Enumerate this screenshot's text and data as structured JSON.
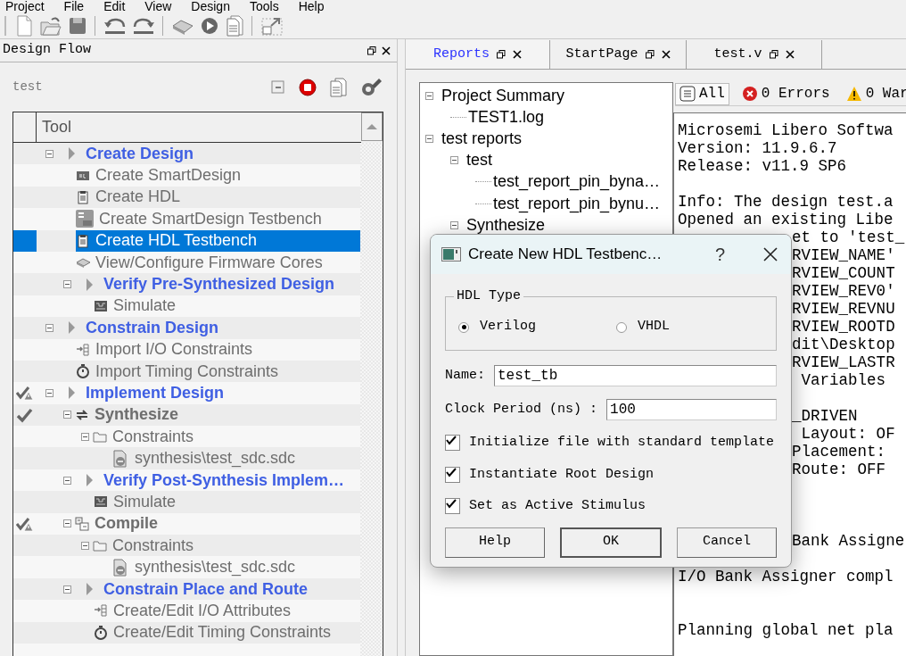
{
  "menu": [
    "Project",
    "File",
    "Edit",
    "View",
    "Design",
    "Tools",
    "Help"
  ],
  "design_flow": {
    "title": "Design Flow",
    "project": "test",
    "column": "Tool",
    "tree": [
      {
        "label": "Create Design",
        "kind": "category",
        "expanded": true,
        "selected": false,
        "checked": false,
        "warning": false,
        "children": [
          {
            "label": "Create SmartDesign",
            "kind": "item",
            "selected": false,
            "checked": false,
            "warning": false
          },
          {
            "label": "Create HDL",
            "kind": "item",
            "selected": false,
            "checked": false,
            "warning": false
          },
          {
            "label": "Create SmartDesign Testbench",
            "kind": "item",
            "selected": false,
            "checked": false,
            "warning": false
          },
          {
            "label": "Create HDL Testbench",
            "kind": "item",
            "selected": true,
            "checked": false,
            "warning": false
          },
          {
            "label": "View/Configure Firmware Cores",
            "kind": "item",
            "selected": false,
            "checked": false,
            "warning": false
          },
          {
            "label": "Verify Pre-Synthesized Design",
            "kind": "category",
            "expanded": true,
            "selected": false,
            "checked": false,
            "warning": false,
            "children": [
              {
                "label": "Simulate",
                "kind": "item",
                "selected": false,
                "checked": false,
                "warning": false
              }
            ]
          }
        ]
      },
      {
        "label": "Constrain Design",
        "kind": "category",
        "expanded": true,
        "selected": false,
        "checked": false,
        "warning": false,
        "children": [
          {
            "label": "Import I/O Constraints",
            "kind": "item",
            "selected": false,
            "checked": false,
            "warning": false
          },
          {
            "label": "Import Timing Constraints",
            "kind": "item",
            "selected": false,
            "checked": false,
            "warning": false
          }
        ]
      },
      {
        "label": "Implement Design",
        "kind": "category",
        "expanded": true,
        "selected": false,
        "checked": true,
        "warning": true,
        "children": [
          {
            "label": "Synthesize",
            "kind": "step",
            "expanded": true,
            "selected": false,
            "checked": true,
            "warning": false,
            "children": [
              {
                "label": "Constraints",
                "kind": "folder",
                "expanded": true,
                "selected": false,
                "checked": false,
                "warning": false,
                "children": [
                  {
                    "label": "synthesis\\test_sdc.sdc",
                    "kind": "item",
                    "selected": false,
                    "checked": false,
                    "warning": false
                  }
                ]
              }
            ]
          },
          {
            "label": "Verify Post-Synthesis Implem…",
            "kind": "category",
            "expanded": true,
            "selected": false,
            "checked": false,
            "warning": false,
            "children": [
              {
                "label": "Simulate",
                "kind": "item",
                "selected": false,
                "checked": false,
                "warning": false
              }
            ]
          },
          {
            "label": "Compile",
            "kind": "step",
            "expanded": true,
            "selected": false,
            "checked": true,
            "warning": true,
            "children": [
              {
                "label": "Constraints",
                "kind": "folder",
                "expanded": true,
                "selected": false,
                "checked": false,
                "warning": false,
                "children": [
                  {
                    "label": "synthesis\\test_sdc.sdc",
                    "kind": "item",
                    "selected": false,
                    "checked": false,
                    "warning": false
                  }
                ]
              }
            ]
          },
          {
            "label": "Constrain Place and Route",
            "kind": "category",
            "expanded": true,
            "selected": false,
            "checked": false,
            "warning": false,
            "children": [
              {
                "label": "Create/Edit I/O Attributes",
                "kind": "item",
                "selected": false,
                "checked": false,
                "warning": false
              },
              {
                "label": "Create/Edit Timing Constraints",
                "kind": "item",
                "selected": false,
                "checked": false,
                "warning": false
              }
            ]
          }
        ]
      }
    ]
  },
  "tabs": [
    {
      "label": "Reports",
      "selected": true
    },
    {
      "label": "StartPage",
      "selected": false
    },
    {
      "label": "test.v",
      "selected": false
    }
  ],
  "reports_tree": [
    {
      "label": "Project Summary",
      "expanded": true,
      "children": [
        {
          "label": "TEST1.log"
        }
      ]
    },
    {
      "label": "test reports",
      "expanded": true,
      "children": [
        {
          "label": "test",
          "expanded": true,
          "children": [
            {
              "label": "test_report_pin_byna…"
            },
            {
              "label": "test_report_pin_bynu…"
            }
          ]
        },
        {
          "label": "Synthesize",
          "expanded": true
        }
      ]
    }
  ],
  "log_filters": [
    {
      "label": "All",
      "kind": "all",
      "selected": true
    },
    {
      "label": "0 Errors",
      "kind": "error",
      "selected": false
    },
    {
      "label": "0 War",
      "kind": "warning",
      "selected": false
    }
  ],
  "log": [
    {
      "kind": "line",
      "text": "Microsemi Libero Softwa"
    },
    {
      "kind": "line",
      "text": "Version: 11.9.6.7"
    },
    {
      "kind": "line",
      "text": "Release: v11.9 SP6"
    },
    {
      "kind": "blank"
    },
    {
      "kind": "line",
      "text": "Info: The design test.a"
    },
    {
      "kind": "line",
      "text": "Opened an existing Libe"
    },
    {
      "kind": "covered",
      "text": "et to 'test_"
    },
    {
      "kind": "covered",
      "text": "RVIEW_NAME'"
    },
    {
      "kind": "covered",
      "text": "RVIEW_COUNT"
    },
    {
      "kind": "covered",
      "text": "RVIEW_REV0'"
    },
    {
      "kind": "covered",
      "text": "RVIEW_REVNU"
    },
    {
      "kind": "covered",
      "text": "RVIEW_ROOTD"
    },
    {
      "kind": "covered",
      "text": "dit\\Desktop"
    },
    {
      "kind": "covered",
      "text": "RVIEW_LASTR"
    },
    {
      "kind": "covered",
      "text": " Variables"
    },
    {
      "kind": "blank"
    },
    {
      "kind": "covered",
      "text": "_DRIVEN"
    },
    {
      "kind": "covered",
      "text": " Layout: OF"
    },
    {
      "kind": "covered",
      "text": "Placement:"
    },
    {
      "kind": "covered",
      "text": "Route: OFF"
    },
    {
      "kind": "blank"
    },
    {
      "kind": "blank"
    },
    {
      "kind": "blank"
    },
    {
      "kind": "covered",
      "text": "Bank Assigne"
    },
    {
      "kind": "blank"
    },
    {
      "kind": "line",
      "text": "I/O Bank Assigner compl"
    },
    {
      "kind": "blank"
    },
    {
      "kind": "blank"
    },
    {
      "kind": "line",
      "text": "Planning global net pla"
    }
  ],
  "dialog": {
    "title": "Create New HDL Testbenc…",
    "help": "?",
    "group": "HDL Type",
    "hdl_types": [
      {
        "label": "Verilog",
        "selected": true
      },
      {
        "label": "VHDL",
        "selected": false
      }
    ],
    "fields": [
      {
        "label": "Name:",
        "value": "test_tb"
      },
      {
        "label": "Clock Period (ns) :",
        "value": "100"
      }
    ],
    "options": [
      {
        "label": "Initialize file with standard template",
        "checked": true
      },
      {
        "label": "Instantiate Root Design",
        "checked": true
      },
      {
        "label": "Set as Active Stimulus",
        "checked": true
      }
    ],
    "buttons": [
      {
        "label": "Help",
        "default": false
      },
      {
        "label": "OK",
        "default": true
      },
      {
        "label": "Cancel",
        "default": false
      }
    ]
  }
}
